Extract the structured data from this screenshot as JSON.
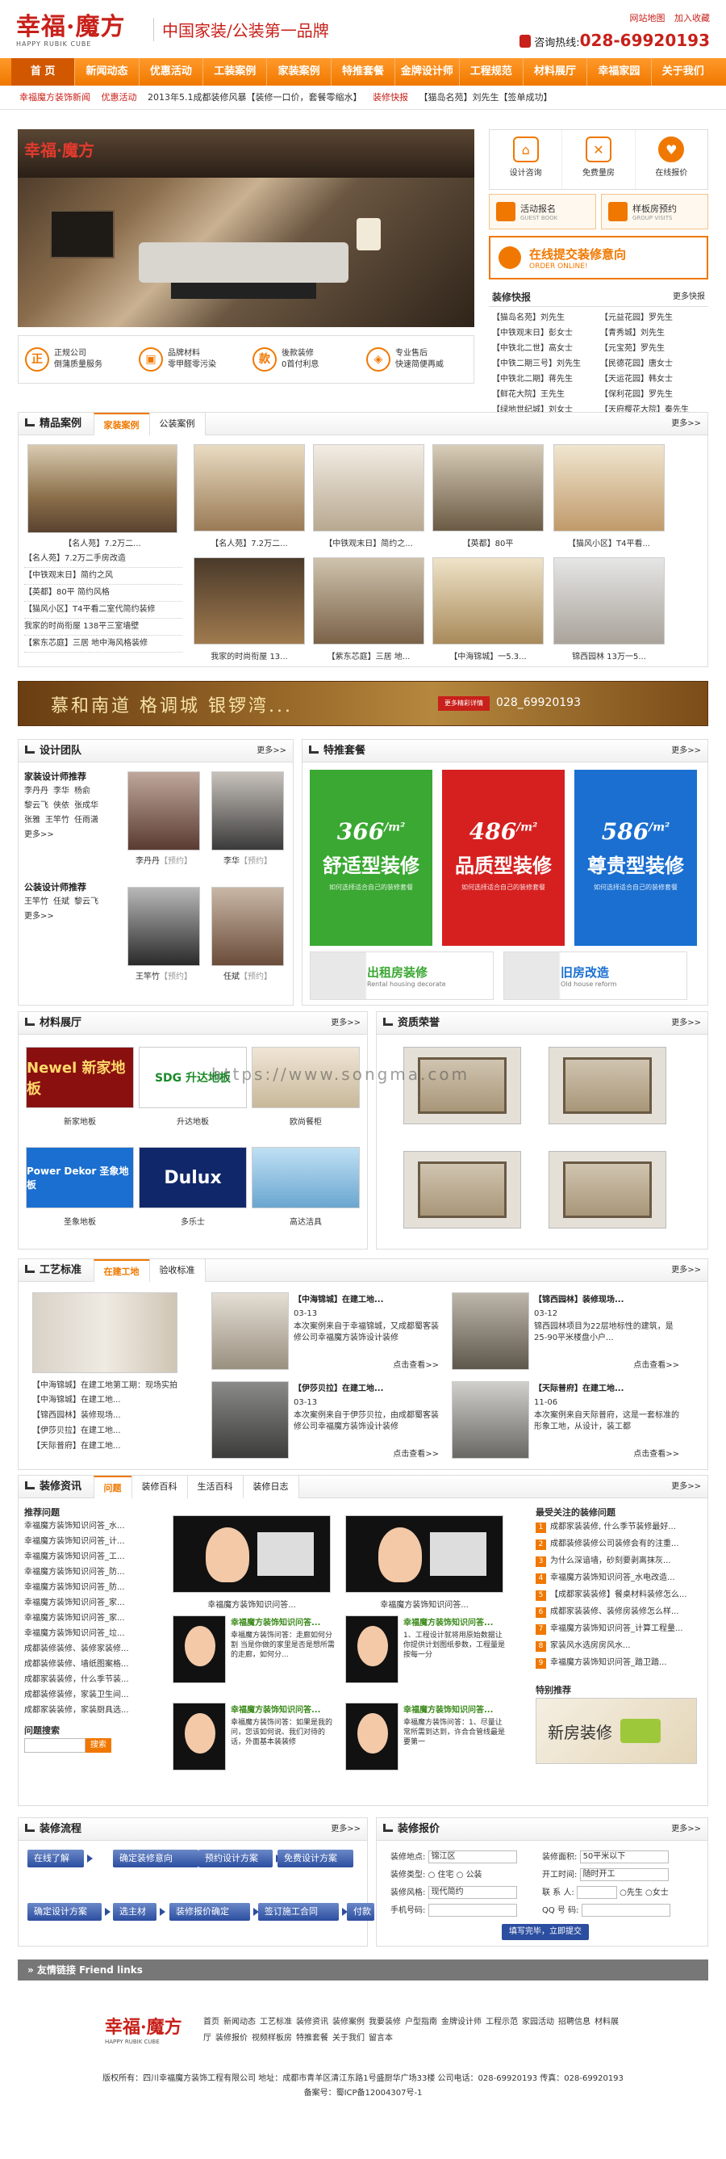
{
  "header": {
    "logo_main": "幸福·魔方",
    "logo_sub": "HAPPY RUBIK CUBE",
    "slogan": "中国家装/公装第一品牌",
    "links": [
      "网站地图",
      "加入收藏"
    ],
    "hotline_label": "咨询热线:",
    "hotline": "028-69920193"
  },
  "nav": [
    "首 页",
    "新闻动态",
    "优惠活动",
    "工装案例",
    "家装案例",
    "特推套餐",
    "金牌设计师",
    "工程规范",
    "材料展厅",
    "幸福家园",
    "关于我们"
  ],
  "newsbar": [
    {
      "t": "幸福魔方装饰新闻",
      "red": true
    },
    {
      "t": "优惠活动",
      "red": true
    },
    {
      "t": "2013年5.1成都装修风暴【装修一口价，套餐零缩水】",
      "red": false
    },
    {
      "t": "装修快报",
      "red": true
    },
    {
      "t": "【猫岛名苑】刘先生【签单成功】",
      "red": false
    }
  ],
  "banner_logo": "幸福·魔方",
  "features": [
    {
      "icon": "正",
      "l1": "正规公司",
      "l2": "倒蒲质量服务"
    },
    {
      "icon": "▣",
      "l1": "品牌材料",
      "l2": "零甲醛零污染"
    },
    {
      "icon": "款",
      "l1": "後款装修",
      "l2": "0首付利息"
    },
    {
      "icon": "◈",
      "l1": "专业售后",
      "l2": "快速简便再威"
    }
  ],
  "services": [
    "设计咨询",
    "免费量房",
    "在线报价"
  ],
  "services2": [
    {
      "t": "活动报名",
      "s": "GUEST BOOK"
    },
    {
      "t": "样板房预约",
      "s": "GROUP VISITS"
    }
  ],
  "order": {
    "t": "在线提交装修意向",
    "s": "ORDER ONLINE!"
  },
  "express": {
    "title": "装修快报",
    "more": "更多快报",
    "items": [
      "【猫岛名苑】刘先生",
      "【元益花园】罗先生",
      "【中铁观末日】彭女士",
      "【青秀城】刘先生",
      "【中铁北二世】高女士",
      "【元宝苑】罗先生",
      "【中铁二期三号】刘先生",
      "【民德花园】唐女士",
      "【中铁北二期】蒋先生",
      "【天运花园】韩女士",
      "【鲜花大院】王先生",
      "【保利花园】罗先生",
      "【绿地世纪城】刘女士",
      "【天府樱花大院】秦先生"
    ]
  },
  "cases": {
    "title": "精品案例",
    "tabs": [
      "家装案例",
      "公装案例"
    ],
    "more": "更多>>",
    "feature_caption": "【名人苑】7.2万二...",
    "list": [
      "【名人苑】7.2万二手房改造",
      "【中铁观末日】简约之风",
      "【英都】80平 简约风格",
      "【猫风小区】T4平看二室代简约装修",
      "我家的时尚衔屋 138平三室墙壁",
      "【紫东芯庭】三居 地中海风格装修"
    ],
    "captions": [
      "【名人苑】7.2万二...",
      "【中铁观末日】简约之...",
      "【英都】80平",
      "【猫风小区】T4平看...",
      "我家的时尚衔屋 13...",
      "【紫东芯庭】三居 地...",
      "【中海锦城】一5.3...",
      "锦西园林 13万一5..."
    ]
  },
  "ad": {
    "text": "慕和南道  格调城  银锣湾...",
    "btn": "更多精彩详情",
    "tel": "028_69920193"
  },
  "designers": {
    "title": "设计团队",
    "more": "更多>>",
    "home_title": "家装设计师推荐",
    "home_rows": [
      [
        "李丹丹",
        "李华",
        "杨俞"
      ],
      [
        "黎云飞",
        "侠依",
        "张成华"
      ],
      [
        "张雅",
        "王竿竹",
        "任雨潇"
      ]
    ],
    "home_more": "更多>>",
    "pub_title": "公装设计师推荐",
    "pub_rows": [
      [
        "王竿竹",
        "任斌",
        "黎云飞"
      ]
    ],
    "pub_more": "更多>>",
    "photos": [
      {
        "name": "李丹丹",
        "tag": "【预约】"
      },
      {
        "name": "李华",
        "tag": "【预约】"
      },
      {
        "name": "王竿竹",
        "tag": "【预约】"
      },
      {
        "name": "任斌",
        "tag": "【预约】"
      }
    ]
  },
  "packages": {
    "title": "特推套餐",
    "more": "更多>>",
    "items": [
      {
        "price": "366",
        "unit": "/m²",
        "name": "舒适型装修",
        "desc": "如何选择适合自己的装修套餐",
        "color": "#3aa832"
      },
      {
        "price": "486",
        "unit": "/m²",
        "name": "品质型装修",
        "desc": "如何选择适合自己的装修套餐",
        "color": "#d62020"
      },
      {
        "price": "586",
        "unit": "/m²",
        "name": "尊贵型装修",
        "desc": "如何选择适合自己的装修套餐",
        "color": "#1a6fd0"
      }
    ],
    "strips": [
      {
        "t": "出租房装修",
        "s": "Rental housing decorate",
        "color": "#3aa832"
      },
      {
        "t": "旧房改造",
        "s": "Old house reform",
        "color": "#1a6fd0"
      }
    ]
  },
  "materials": {
    "title": "材料展厅",
    "more": "更多>>",
    "items": [
      {
        "logo": "Newel 新家地板",
        "cap": "新家地板"
      },
      {
        "logo": "SDG 升达地板",
        "cap": "升达地板"
      },
      {
        "logo": "",
        "cap": "欧尚餐柜"
      },
      {
        "logo": "Power Dekor 圣象地板",
        "cap": "圣象地板"
      },
      {
        "logo": "Dulux",
        "cap": "多乐士"
      },
      {
        "logo": "",
        "cap": "高达洁具"
      }
    ]
  },
  "honors": {
    "title": "资质荣誉",
    "more": "更多>>"
  },
  "watermark": "https://www.songma.com",
  "process": {
    "title": "工艺标准",
    "tabs": [
      "在建工地",
      "验收标准"
    ],
    "more": "更多>>",
    "caption": "【中海锦城】在建工地第工期：现场实拍",
    "list": [
      "【中海锦城】在建工地...",
      "【锦西园林】装修现场...",
      "【伊莎贝拉】在建工地...",
      "【天际普府】在建工地..."
    ],
    "items": [
      {
        "h": "【中海锦城】在建工地...",
        "date": "03-13",
        "d": "本次案例来自于幸福锦城，又成都蜀客装修公司幸福魔方装饰设计装修",
        "m": "点击查看>>"
      },
      {
        "h": "【锦西园林】装修现场...",
        "date": "03-12",
        "d": "锦西园林项目为22层地标性的建筑，是25-90平米楼盘小户...",
        "m": "点击查看>>"
      },
      {
        "h": "【伊莎贝拉】在建工地...",
        "date": "03-13",
        "d": "本次案例来自于伊莎贝拉，由成都蜀客装修公司幸福魔方装饰设计装修",
        "m": "点击查看>>"
      },
      {
        "h": "【天际普府】在建工地...",
        "date": "11-06",
        "d": "本次案例来自天际普府，这是一套标准的形象工地，从设计，装工都",
        "m": "点击查看>>"
      }
    ]
  },
  "info": {
    "title": "装修资讯",
    "tabs": [
      "问题",
      "装修百科",
      "生活百科",
      "装修日志"
    ],
    "more": "更多>>",
    "left_title": "推荐问题",
    "left_list": [
      "幸福魔方装饰知识问答_水...",
      "幸福魔方装饰知识问答_计...",
      "幸福魔方装饰知识问答_工...",
      "幸福魔方装饰知识问答_防...",
      "幸福魔方装饰知识问答_防...",
      "幸福魔方装饰知识问答_家...",
      "幸福魔方装饰知识问答_家...",
      "幸福魔方装饰知识问答_垃...",
      "成都装修装修、装修家装修...",
      "成都装修装修、墙纸图案格...",
      "成都家装装修，什么季节装...",
      "成都装修装修，家装卫生间...",
      "成都家装装修，家装厨具选..."
    ],
    "search_title": "问题搜索",
    "search_btn": "搜索",
    "big_caps": [
      "幸福魔方装饰知识问答...",
      "幸福魔方装饰知识问答..."
    ],
    "small": [
      {
        "h": "幸福魔方装饰知识问答...",
        "d": "幸福魔方装饰问答：走廊如何分割 当是你做的家里是否是想所需的走廊，如何分..."
      },
      {
        "h": "幸福魔方装饰知识问答...",
        "d": "1、工程设计就将用原始数据让你提供计划图纸参数，工程量是按每一分"
      },
      {
        "h": "幸福魔方装饰知识问答...",
        "d": "幸福魔方装饰问答：如果是我的问，您该如何说、我们对待的话，外面基本装装修"
      },
      {
        "h": "幸福魔方装饰知识问答...",
        "d": "幸福魔方装饰问答：1、尽量让常所需到达到，许合合管线最是要第一"
      }
    ],
    "right_title": "最受关注的装修问题",
    "right_list": [
      "成都家装装修, 什么季节装修最好...",
      "成都装修装修公司装修会有的注重...",
      "为什么深谙墙，砂刻要剥离抹灰...",
      "幸福魔方装饰知识问答_水电改造...",
      "【成都家装装修】餐桌材料装修怎么...",
      "成都家装装修、装修房装修怎么样...",
      "幸福魔方装饰知识问答_计算工程量...",
      "家装风水选房房风水...",
      "幸福魔方装饰知识问答_踏卫踏..."
    ],
    "special": "特别推荐",
    "special_img": "新房装修"
  },
  "flowbox": {
    "title": "装修流程",
    "more": "更多>>",
    "steps": [
      "在线了解",
      "确定装修意向",
      "预约设计方案",
      "免费设计方案",
      "确定设计方案",
      "选主材",
      "装修报价确定",
      "签订施工合同",
      "付款"
    ]
  },
  "quote": {
    "title": "装修报价",
    "more": "更多>>",
    "labels": [
      "装修地点:",
      "装修面积:",
      "装修类型:",
      "开工时间:",
      "装修风格:",
      "联 系 人:",
      "手机号码:",
      "QQ 号 码:"
    ],
    "values": {
      "area": "锦江区",
      "size": "50平米以下",
      "type1": "住宅",
      "type2": "公装",
      "start": "随时开工",
      "style": "现代简约",
      "sex1": "先生",
      "sex2": "女士"
    },
    "submit": "填写完毕，立即提交"
  },
  "friend": "友情链接 Friend links",
  "footer": {
    "nav": [
      "首页",
      "新闻动态",
      "工艺标准",
      "装修资讯",
      "装修案例",
      "我要装修",
      "户型指南",
      "金牌设计师",
      "工程示范",
      "家园活动",
      "招聘信息",
      "材料展厅",
      "装修报价",
      "视频样板房",
      "特推套餐",
      "关于我们",
      "留言本"
    ],
    "copy1": "版权所有：四川幸福魔方装饰工程有限公司   地址：成都市青羊区清江东路1号盛厨华广场33楼   公司电话：028-69920193   传真：028-69920193",
    "copy2": "备案号：蜀ICP备12004307号-1"
  },
  "colors": {
    "accent": "#f07800",
    "brand": "#c8201a",
    "flow": "#2c4ea0"
  }
}
